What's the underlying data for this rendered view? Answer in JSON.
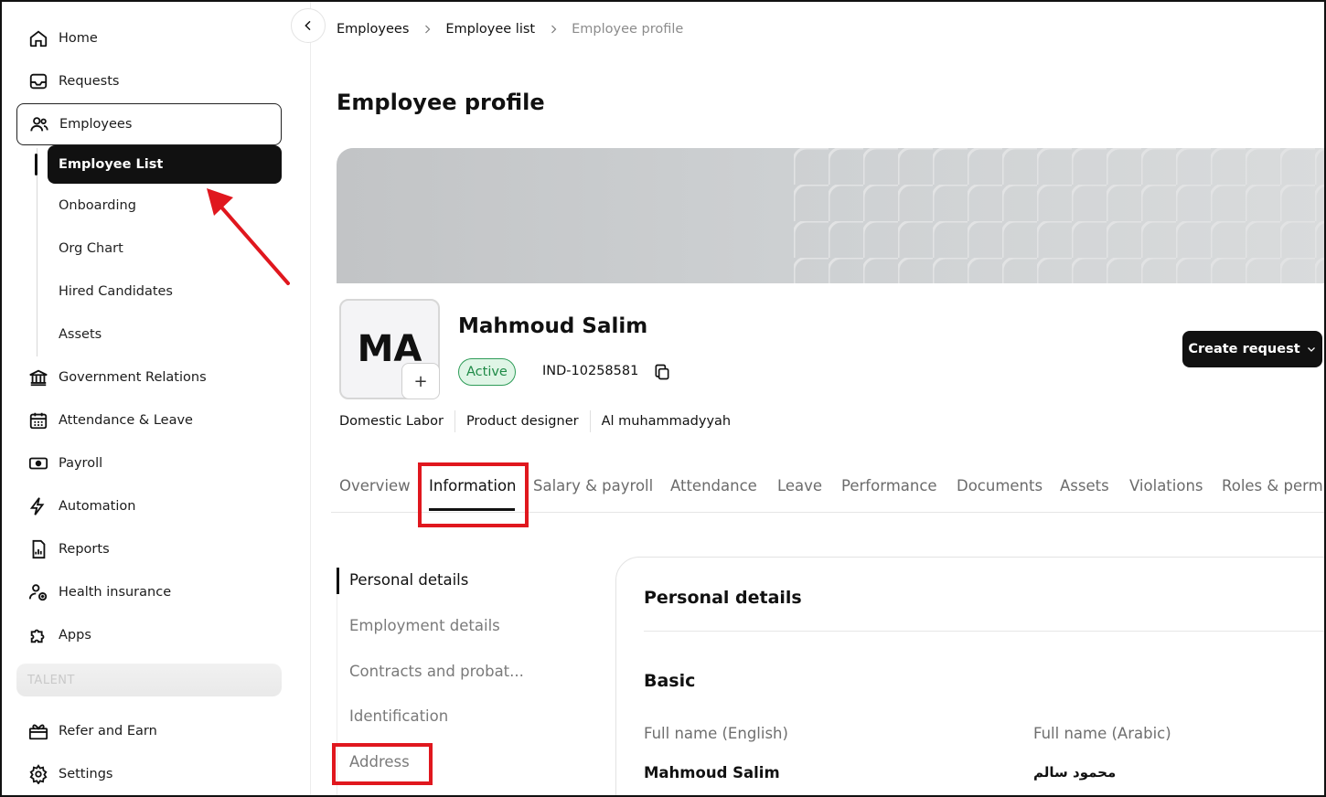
{
  "sidebar": {
    "items": [
      {
        "label": "Home",
        "icon": "home-icon"
      },
      {
        "label": "Requests",
        "icon": "inbox-icon"
      },
      {
        "label": "Employees",
        "icon": "users-icon"
      },
      {
        "label": "Government Relations",
        "icon": "bank-icon"
      },
      {
        "label": "Attendance & Leave",
        "icon": "calendar-icon"
      },
      {
        "label": "Payroll",
        "icon": "money-icon"
      },
      {
        "label": "Automation",
        "icon": "lightning-icon"
      },
      {
        "label": "Reports",
        "icon": "report-icon"
      },
      {
        "label": "Health insurance",
        "icon": "health-user-icon"
      },
      {
        "label": "Apps",
        "icon": "puzzle-icon"
      },
      {
        "label": "Refer and Earn",
        "icon": "gift-icon"
      },
      {
        "label": "Settings",
        "icon": "gear-icon"
      }
    ],
    "employees_sub": [
      "Employee List",
      "Onboarding",
      "Org Chart",
      "Hired Candidates",
      "Assets"
    ],
    "talent_label": "TALENT"
  },
  "breadcrumb": [
    "Employees",
    "Employee list",
    "Employee profile"
  ],
  "page_title": "Employee profile",
  "profile": {
    "initials": "MA",
    "add_symbol": "+",
    "name": "Mahmoud Salim",
    "status": "Active",
    "employee_id": "IND-10258581",
    "tags": [
      "Domestic Labor",
      "Product designer",
      "Al muhammadyyah"
    ]
  },
  "create_request_label": "Create request",
  "tabs": [
    "Overview",
    "Information",
    "Salary & payroll",
    "Attendance",
    "Leave",
    "Performance",
    "Documents",
    "Assets",
    "Violations",
    "Roles & permi"
  ],
  "subnav": [
    "Personal details",
    "Employment details",
    "Contracts and probat...",
    "Identification",
    "Address"
  ],
  "card": {
    "title": "Personal details",
    "section": "Basic",
    "fields": [
      {
        "label": "Full name (English)",
        "value": "Mahmoud Salim"
      },
      {
        "label": "Full name (Arabic)",
        "value": "محمود سالم"
      }
    ]
  },
  "colors": {
    "accent": "#111111",
    "highlight": "#e0171e",
    "status_green": "#1f8a47"
  }
}
